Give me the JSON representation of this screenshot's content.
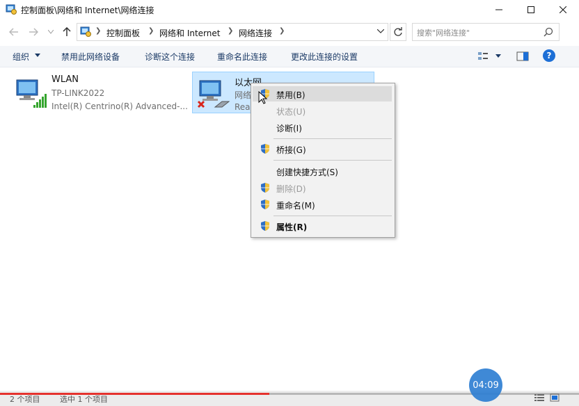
{
  "window": {
    "title": "控制面板\\网络和 Internet\\网络连接"
  },
  "address": {
    "crumbs": [
      "控制面板",
      "网络和 Internet",
      "网络连接"
    ],
    "search_placeholder": "搜索\"网络连接\""
  },
  "commands": {
    "organize": "组织",
    "disable_device": "禁用此网络设备",
    "diagnose": "诊断这个连接",
    "rename": "重命名此连接",
    "change_settings": "更改此连接的设置"
  },
  "connections": [
    {
      "name": "WLAN",
      "network": "TP-LINK2022",
      "device": "Intel(R) Centrino(R) Advanced-..."
    },
    {
      "name": "以太网",
      "network": "网络",
      "device": "Rea"
    }
  ],
  "context_menu": {
    "items": [
      {
        "label": "禁用(B)",
        "state": "highlighted",
        "shield": true
      },
      {
        "label": "状态(U)",
        "state": "disabled",
        "shield": false
      },
      {
        "label": "诊断(I)",
        "state": "normal",
        "shield": false
      },
      {
        "label": "桥接(G)",
        "state": "normal",
        "shield": true
      },
      {
        "label": "创建快捷方式(S)",
        "state": "normal",
        "shield": false
      },
      {
        "label": "删除(D)",
        "state": "disabled",
        "shield": true
      },
      {
        "label": "重命名(M)",
        "state": "normal",
        "shield": true
      },
      {
        "label": "属性(R)",
        "state": "default",
        "shield": true
      }
    ]
  },
  "status": {
    "item_count": "2 个项目",
    "selected": "选中 1 个项目"
  },
  "video": {
    "time": "04:09",
    "progress": 0.465
  },
  "colors": {
    "selection_bg": "#cce8ff",
    "accent": "#1d6fd6",
    "progress": "#e5322d"
  }
}
